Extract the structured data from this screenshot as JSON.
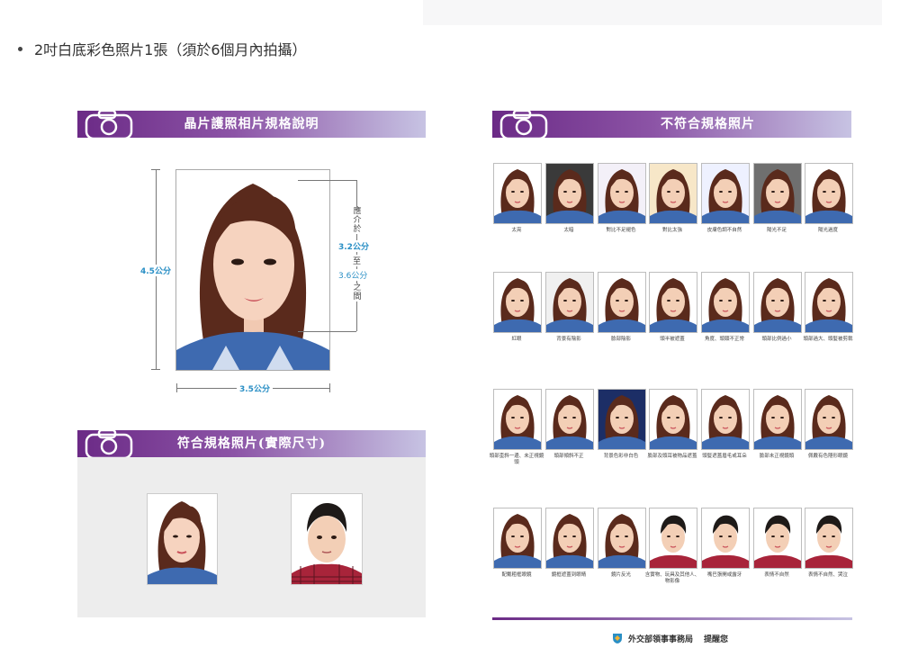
{
  "bullet": {
    "text": "2吋白底彩色照片1張（須於6個月內拍攝）"
  },
  "left_panel": {
    "title": "晶片護照相片規格說明",
    "height_label": "4.5公分",
    "width_label": "3.5公分",
    "range_labels": [
      "應介於",
      "3.2公分",
      "至",
      "3.6公分",
      "之間"
    ]
  },
  "conform_panel": {
    "title": "符合規格照片(實際尺寸)"
  },
  "right_panel": {
    "title": "不符合規格照片",
    "captions": [
      [
        "太亮",
        "太暗",
        "對比不足褪色",
        "對比太強",
        "皮膚色調不自然",
        "陽光不足",
        "陽光過度"
      ],
      [
        "紅眼",
        "背景有陰影",
        "臉部陰影",
        "頭半被遮蓋",
        "角度、頭頸不正常",
        "頭部比例過小",
        "頭部過大、頭髮被剪裁"
      ],
      [
        "頭部歪斜一邊、未正視鏡頭",
        "頭部傾斜不正",
        "背景色彩非白色",
        "臉部及頭耳被物品遮蓋",
        "頭髮遮蓋眉毛或耳朵",
        "臉部未正視鏡頭",
        "佩戴有色隱形眼鏡"
      ],
      [
        "配戴粗框眼鏡",
        "鏡框遮蓋到眼睛",
        "鏡片反光",
        "含實物、玩具及其他人、物影像",
        "嘴巴張開或露牙",
        "表情不自然",
        "表情不自然、哭泣"
      ]
    ]
  },
  "footer": {
    "org": "外交部領事事務局",
    "remind": "提醒您"
  }
}
